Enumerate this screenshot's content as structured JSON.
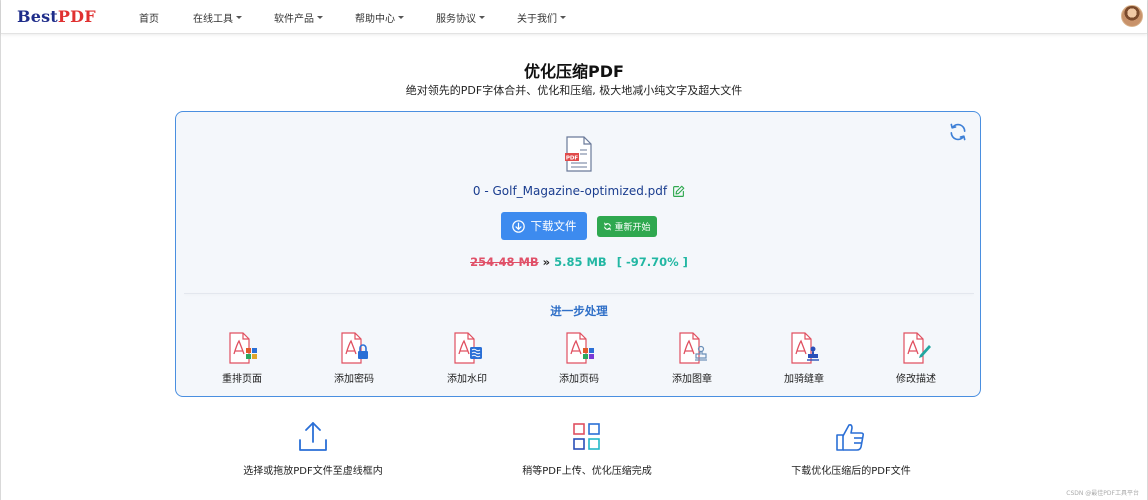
{
  "navbar": {
    "logo_part1": "Best",
    "logo_part2": "PDF",
    "items": [
      {
        "label": "首页",
        "dropdown": false
      },
      {
        "label": "在线工具",
        "dropdown": true
      },
      {
        "label": "软件产品",
        "dropdown": true
      },
      {
        "label": "帮助中心",
        "dropdown": true
      },
      {
        "label": "服务协议",
        "dropdown": true
      },
      {
        "label": "关于我们",
        "dropdown": true
      }
    ],
    "avatar_icon": "user-avatar"
  },
  "header": {
    "title": "优化压缩PDF",
    "subtitle": "绝对领先的PDF字体合并、优化和压缩, 极大地减小纯文字及超大文件"
  },
  "result": {
    "filename": "0 - Golf_Magazine-optimized.pdf",
    "download_label": "下载文件",
    "restart_label": "重新开始",
    "old_size": "254.48 MB",
    "separator": "»",
    "new_size": "5.85 MB",
    "reduction": "[ -97.70% ]",
    "file_icon_text": "PDF"
  },
  "further": {
    "title": "进一步处理",
    "tools": [
      {
        "label": "重排页面",
        "icon": "reorder-pages-icon"
      },
      {
        "label": "添加密码",
        "icon": "add-password-icon"
      },
      {
        "label": "添加水印",
        "icon": "add-watermark-icon"
      },
      {
        "label": "添加页码",
        "icon": "add-page-number-icon"
      },
      {
        "label": "添加图章",
        "icon": "add-stamp-icon"
      },
      {
        "label": "加骑缝章",
        "icon": "add-seam-stamp-icon"
      },
      {
        "label": "修改描述",
        "icon": "edit-description-icon"
      }
    ]
  },
  "steps": [
    {
      "label": "选择或拖放PDF文件至虚线框内",
      "icon": "upload-icon"
    },
    {
      "label": "稍等PDF上传、优化压缩完成",
      "icon": "grid-icon"
    },
    {
      "label": "下载优化压缩后的PDF文件",
      "icon": "thumbs-up-icon"
    }
  ],
  "watermark": "CSDN @最佳PDF工具平台",
  "colors": {
    "brand_blue": "#1f2d8a",
    "brand_red": "#e03131",
    "accent_blue": "#3d8bef",
    "success_green": "#2fa84f",
    "teal": "#22b7a3",
    "strike_red": "#e05068"
  }
}
